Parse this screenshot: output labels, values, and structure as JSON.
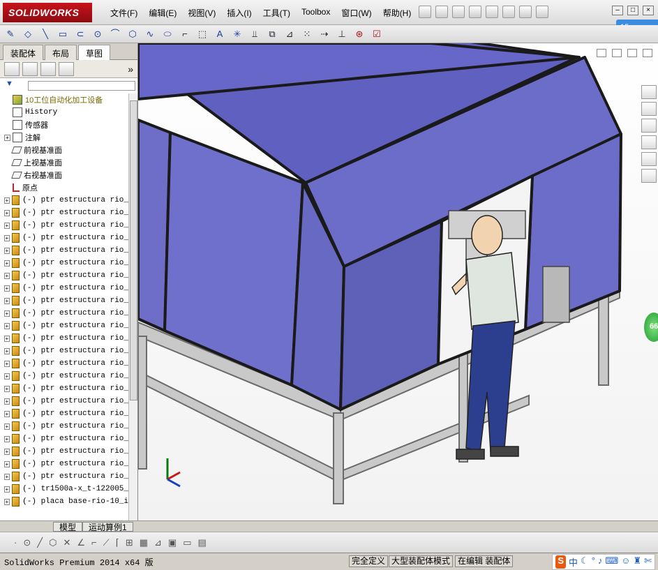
{
  "app": {
    "name": "SOLIDWORKS"
  },
  "menu": [
    "文件(F)",
    "编辑(E)",
    "视图(V)",
    "插入(I)",
    "工具(T)",
    "Toolbox",
    "窗口(W)",
    "帮助(H)"
  ],
  "cloud": {
    "label": "15"
  },
  "tabs": [
    "装配体",
    "布局",
    "草图"
  ],
  "tree": {
    "root": "10工位自动化加工设备",
    "fixed": [
      "History",
      "传感器",
      "注解",
      "前视基准面",
      "上视基准面",
      "右视基准面",
      "原点"
    ],
    "parts": [
      "(-) ptr estructura rio_",
      "(-) ptr estructura rio_",
      "(-) ptr estructura rio_",
      "(-) ptr estructura rio_",
      "(-) ptr estructura rio_",
      "(-) ptr estructura rio_",
      "(-) ptr estructura rio_",
      "(-) ptr estructura rio_",
      "(-) ptr estructura rio_",
      "(-) ptr estructura rio_",
      "(-) ptr estructura rio_",
      "(-) ptr estructura rio_",
      "(-) ptr estructura rio_",
      "(-) ptr estructura rio_",
      "(-) ptr estructura rio_",
      "(-) ptr estructura rio_",
      "(-) ptr estructura rio_",
      "(-) ptr estructura rio_",
      "(-) ptr estructura rio_",
      "(-) ptr estructura rio_",
      "(-) ptr estructura rio_",
      "(-) ptr estructura rio_",
      "(-) ptr estructura rio_",
      "(-) tr1500a-x_t-122005_",
      "(-) placa base-rio-10_i"
    ]
  },
  "bottom_tabs": {
    "model": "模型",
    "motion": "运动算例1"
  },
  "status": {
    "product": "SolidWorks Premium 2014 x64 版",
    "fully_defined": "完全定义",
    "large_mode": "大型装配体模式",
    "editing": "在编辑 装配体"
  },
  "ime": {
    "logo": "S",
    "lang": "中"
  },
  "badge": {
    "value": "66"
  }
}
